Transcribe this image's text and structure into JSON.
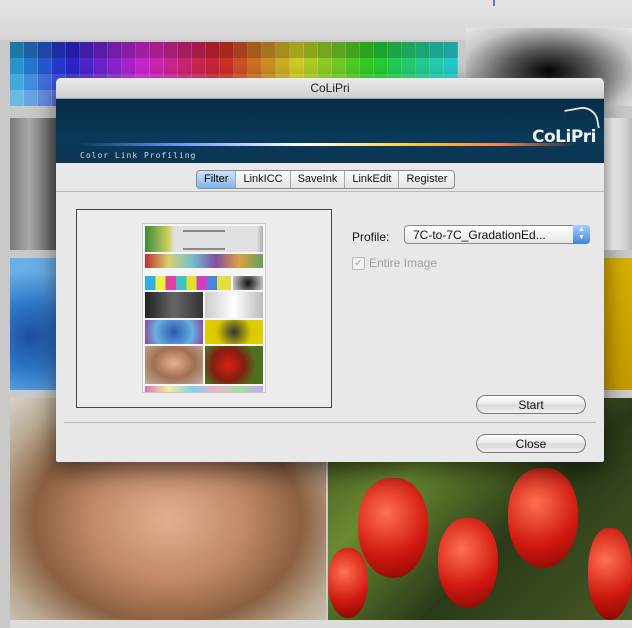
{
  "window": {
    "title": "CoLiPri"
  },
  "banner": {
    "tagline": "Color Link Profiling",
    "logo_text": "CoLiPri"
  },
  "tabs": [
    {
      "label": "Filter",
      "active": true
    },
    {
      "label": "LinkICC",
      "active": false
    },
    {
      "label": "SaveInk",
      "active": false
    },
    {
      "label": "LinkEdit",
      "active": false
    },
    {
      "label": "Register",
      "active": false
    }
  ],
  "filter": {
    "profile_label": "Profile:",
    "profile_value": "7C-to-7C_GradationEd...",
    "entire_image_label": "Entire Image",
    "entire_image_checked": true,
    "entire_image_enabled": false,
    "start_label": "Start",
    "close_label": "Close"
  },
  "colors": {
    "banner": "#0a3a5a",
    "tab_active": "#7fb4ec",
    "popup_arrows": "#3a86e0"
  }
}
